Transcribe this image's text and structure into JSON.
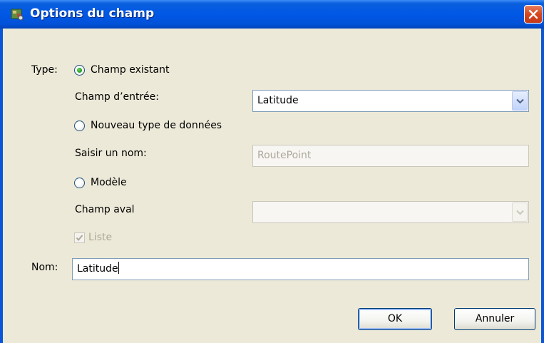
{
  "window": {
    "title": "Options du champ"
  },
  "form": {
    "type_label": "Type:",
    "option_existing": "Champ existant",
    "input_field_label": "Champ d’entrée:",
    "input_field_value": "Latitude",
    "option_new_type": "Nouveau type de données",
    "enter_name_label": "Saisir un nom:",
    "enter_name_placeholder": "RoutePoint",
    "option_model": "Modèle",
    "downstream_label": "Champ aval",
    "downstream_value": "",
    "list_label": "Liste",
    "list_checked": true,
    "name_label": "Nom:",
    "name_value": "Latitude",
    "selected_option": "Champ existant"
  },
  "buttons": {
    "ok": "OK",
    "cancel": "Annuler"
  },
  "colors": {
    "titlebar": "#0058e6",
    "dialog_bg": "#ece9d8",
    "close": "#d4471f"
  }
}
